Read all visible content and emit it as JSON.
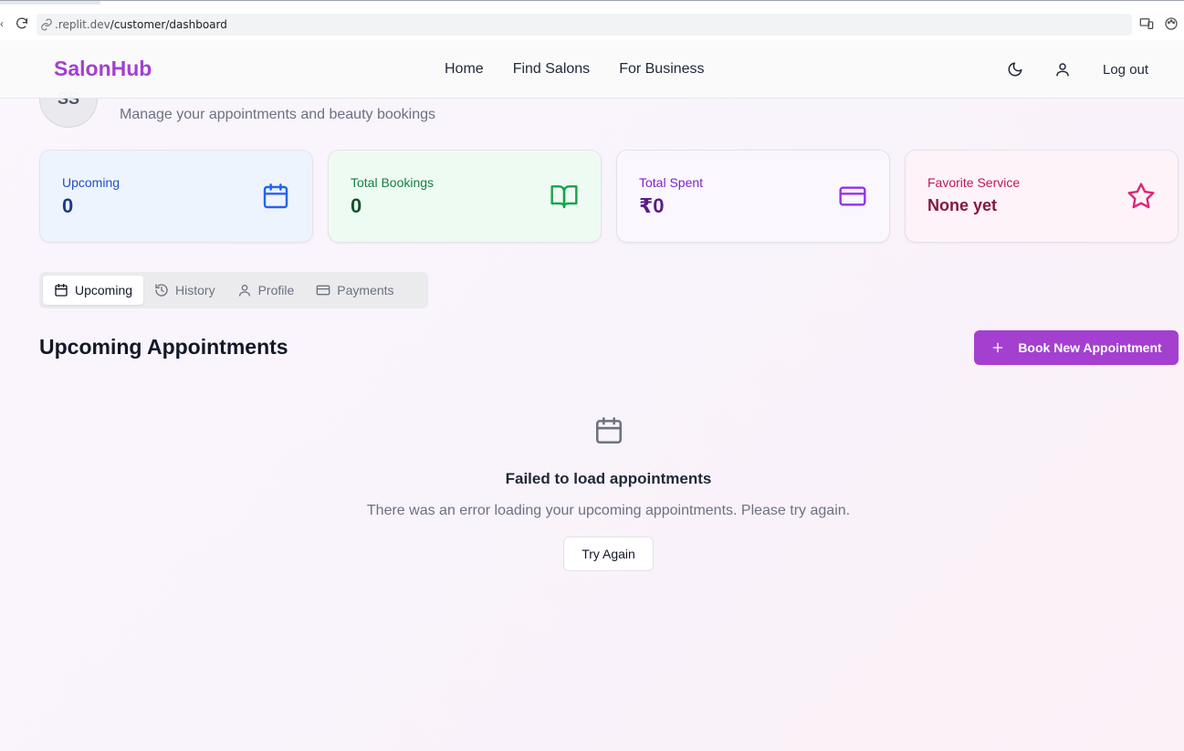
{
  "browser": {
    "url_host": ".replit.dev",
    "url_path": "/customer/dashboard"
  },
  "nav": {
    "brand": "SalonHub",
    "links": [
      "Home",
      "Find Salons",
      "For Business"
    ],
    "logout": "Log out"
  },
  "profile": {
    "initials": "SS",
    "subtitle": "Manage your appointments and beauty bookings"
  },
  "stats": {
    "upcoming": {
      "label": "Upcoming",
      "value": "0"
    },
    "total_bookings": {
      "label": "Total Bookings",
      "value": "0"
    },
    "total_spent": {
      "label": "Total Spent",
      "value": "₹0"
    },
    "favorite_service": {
      "label": "Favorite Service",
      "value": "None yet"
    }
  },
  "tabs": [
    "Upcoming",
    "History",
    "Profile",
    "Payments"
  ],
  "section": {
    "title": "Upcoming Appointments",
    "book_button": "Book New Appointment"
  },
  "empty_state": {
    "title": "Failed to load appointments",
    "description": "There was an error loading your upcoming appointments. Please try again.",
    "retry": "Try Again"
  },
  "colors": {
    "brand": "#a43fd0",
    "blue": "#2563eb",
    "green": "#16a34a",
    "purple": "#9333ea",
    "pink": "#db2777"
  }
}
